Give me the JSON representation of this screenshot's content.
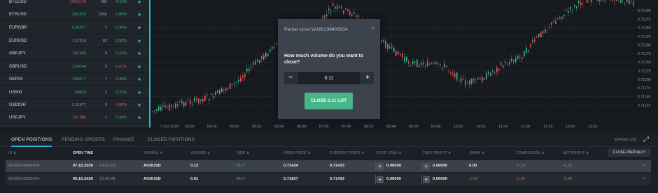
{
  "watchlist": [
    {
      "symbol": "BTCUSD",
      "price": "10613.75",
      "volume": "482",
      "change": "0.11%",
      "price_dir": "dn",
      "change_dir": "up"
    },
    {
      "symbol": "ETHUSD",
      "price": "339.876",
      "volume": "2566",
      "change": "0.06%",
      "price_dir": "up",
      "change_dir": "up"
    },
    {
      "symbol": "EURGBP",
      "price": "0.91377",
      "volume": "2",
      "change": "0.30%",
      "price_dir": "up",
      "change_dir": "up"
    },
    {
      "symbol": "EURUSD",
      "price": "1.17618",
      "volume": "62",
      "change": "0.33%",
      "price_dir": "up",
      "change_dir": "up"
    },
    {
      "symbol": "GBPJPY",
      "price": "136.425",
      "volume": "9",
      "change": "0.33%",
      "price_dir": "up",
      "change_dir": "up"
    },
    {
      "symbol": "GBPUSD",
      "price": "1.28744",
      "volume": "5",
      "change": "-0.07%",
      "price_dir": "up",
      "change_dir": "dn"
    },
    {
      "symbol": "GER30",
      "price": "12847.7",
      "volume": "7",
      "change": "0.39%",
      "price_dir": "up",
      "change_dir": "up"
    },
    {
      "symbol": "US500",
      "price": "3388.9",
      "volume": "2",
      "change": "1.37%",
      "price_dir": "up",
      "change_dir": "up"
    },
    {
      "symbol": "USDCHF",
      "price": "0.91877",
      "volume": "3",
      "change": "-0.08%",
      "price_dir": "up",
      "change_dir": "dn"
    },
    {
      "symbol": "USDJPY",
      "price": "105.886",
      "volume": "1",
      "change": "0.30%",
      "price_dir": "dn",
      "change_dir": "up"
    }
  ],
  "chart": {
    "price_labels": [
      "0.71400",
      "0.71375",
      "0.71350",
      "0.71325",
      "0.71300",
      "0.71275",
      "0.71250",
      "0.71225",
      "0.71200",
      "0.71175",
      "0.71150",
      "0.71125"
    ],
    "time_labels": [
      "7 Oct 2020",
      "03:56",
      "04:28",
      "05:00",
      "05:32",
      "06:04",
      "06:36",
      "07:08",
      "07:40",
      "08:12",
      "08:44",
      "09:16",
      "09:48",
      "10:20",
      "10:52",
      "11:24",
      "11:56",
      "12:28",
      "13:00",
      "13:32"
    ],
    "up_color": "#35b88a",
    "down_color": "#e05a5a"
  },
  "modal": {
    "title": "Partial close W160198406834",
    "close_icon": "×",
    "question": "How much volume do you want to close?",
    "minus": "−",
    "plus": "+",
    "volume_value": "0.11",
    "button_label": "CLOSE 0.11 LOT"
  },
  "tabs": {
    "items": [
      "OPEN POSITIONS",
      "PENDING ORDERS",
      "FINANCE",
      "CLOSED POSITIONS"
    ],
    "expand_label": "EXPAND LIST",
    "expand_icon": "⤢"
  },
  "table": {
    "headers": [
      "ID ⇅",
      "OPEN TIME",
      "SYMBOL ⇅",
      "VOLUME ⇅",
      "SIDE ⇅",
      "OPEN PRICE ⇅",
      "CURRENT PRICE ⇅",
      "STOP LOSS ⇅",
      "TAKE PROFIT ⇅",
      "SWAP ⇅",
      "COMMISSION ⇅",
      "NET PROFIT ⇅"
    ],
    "close_partially": "CLOSE PARTIALLY",
    "rows": [
      {
        "id": "W160198406834",
        "open_time": "07.10.2020",
        "open_clock": "14:02:23",
        "symbol": "AUDUSD",
        "volume": "0.12",
        "side": "BUY",
        "open_price": "0.71434",
        "current_price": "0.71433",
        "stop_loss": "0.00000",
        "take_profit": "0.00000",
        "swap": "0.00",
        "commission": "-0.29",
        "net_profit": "-0.29"
      },
      {
        "id": "W160193055024",
        "open_time": "05.10.2020",
        "open_clock": "12:45:28",
        "symbol": "AUDUSD",
        "volume": "0.01",
        "side": "BUY",
        "open_price": "0.71827",
        "current_price": "0.71433",
        "stop_loss": "0.00000",
        "take_profit": "0.00000",
        "swap": "-0.02",
        "commission": "-0.02",
        "net_profit": "-3.98"
      }
    ]
  }
}
